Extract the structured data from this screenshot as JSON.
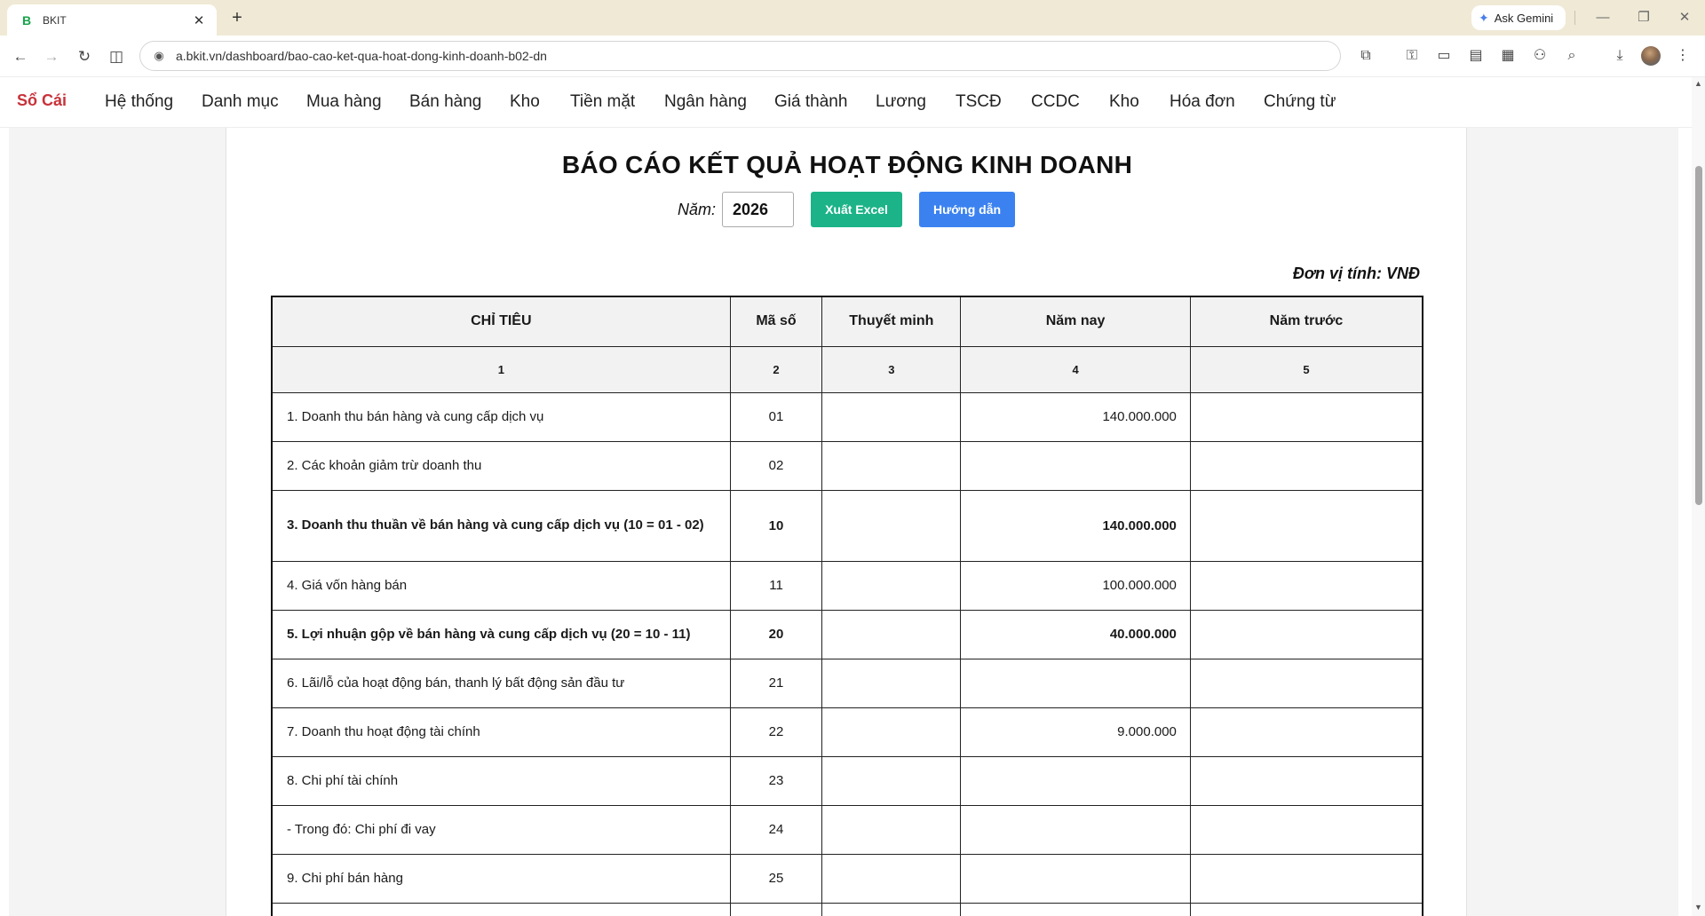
{
  "browser": {
    "tab_title": "BKIT",
    "tab_favicon": "B",
    "new_tab": "+",
    "url": "a.bkit.vn/dashboard/bao-cao-ket-qua-hoat-dong-kinh-doanh-b02-dn",
    "gemini_label": "Ask Gemini"
  },
  "nav": {
    "brand": "Sổ Cái",
    "items": [
      "Hệ thống",
      "Danh mục",
      "Mua hàng",
      "Bán hàng",
      "Kho",
      "Tiền mặt",
      "Ngân hàng",
      "Giá thành",
      "Lương",
      "TSCĐ",
      "CCDC",
      "Kho",
      "Hóa đơn",
      "Chứng từ"
    ]
  },
  "report": {
    "title": "BÁO CÁO KẾT QUẢ HOẠT ĐỘNG KINH DOANH",
    "year_label": "Năm:",
    "year_value": "2026",
    "export_button": "Xuất Excel",
    "guide_button": "Hướng dẫn",
    "unit": "Đơn vị tính: VNĐ",
    "headers": [
      "CHỈ TIÊU",
      "Mã số",
      "Thuyết minh",
      "Năm nay",
      "Năm trước"
    ],
    "header_numbers": [
      "1",
      "2",
      "3",
      "4",
      "5"
    ],
    "rows": [
      {
        "name": "1. Doanh thu bán hàng và cung cấp dịch vụ",
        "code": "01",
        "note": "",
        "this_year": "140.000.000",
        "last_year": "",
        "bold": false
      },
      {
        "name": "2. Các khoản giảm trừ doanh thu",
        "code": "02",
        "note": "",
        "this_year": "",
        "last_year": "",
        "bold": false
      },
      {
        "name": "3. Doanh thu thuần về bán hàng và cung cấp dịch vụ (10 = 01 - 02)",
        "code": "10",
        "note": "",
        "this_year": "140.000.000",
        "last_year": "",
        "bold": true
      },
      {
        "name": "4. Giá vốn hàng bán",
        "code": "11",
        "note": "",
        "this_year": "100.000.000",
        "last_year": "",
        "bold": false
      },
      {
        "name": "5. Lợi nhuận gộp về bán hàng và cung cấp dịch vụ (20 = 10 - 11)",
        "code": "20",
        "note": "",
        "this_year": "40.000.000",
        "last_year": "",
        "bold": true
      },
      {
        "name": "6. Lãi/lỗ của hoạt động bán, thanh lý bất động sản đầu tư",
        "code": "21",
        "note": "",
        "this_year": "",
        "last_year": "",
        "bold": false
      },
      {
        "name": "7. Doanh thu hoạt động tài chính",
        "code": "22",
        "note": "",
        "this_year": "9.000.000",
        "last_year": "",
        "bold": false
      },
      {
        "name": "8. Chi phí tài chính",
        "code": "23",
        "note": "",
        "this_year": "",
        "last_year": "",
        "bold": false
      },
      {
        "name": "- Trong đó: Chi phí đi vay",
        "code": "24",
        "note": "",
        "this_year": "",
        "last_year": "",
        "bold": false
      },
      {
        "name": "9. Chi phí bán hàng",
        "code": "25",
        "note": "",
        "this_year": "",
        "last_year": "",
        "bold": false
      },
      {
        "name": "",
        "code": "",
        "note": "",
        "this_year": "",
        "last_year": "",
        "bold": false
      }
    ]
  }
}
